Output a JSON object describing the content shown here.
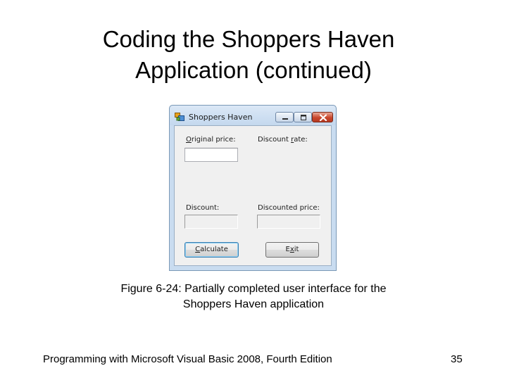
{
  "slide": {
    "title_line1": "Coding the Shoppers Haven",
    "title_line2": "Application (continued)",
    "caption_line1": "Figure 6-24: Partially completed user interface for the",
    "caption_line2": "Shoppers Haven application",
    "footer": "Programming with Microsoft Visual Basic 2008, Fourth Edition",
    "page_number": "35"
  },
  "window": {
    "title": "Shoppers Haven",
    "icon": "app-form-icon",
    "controls": [
      "minimize-icon",
      "maximize-icon",
      "close-icon"
    ]
  },
  "form": {
    "original_price_label": {
      "mnemonic": "O",
      "rest": "riginal price:"
    },
    "discount_rate_label": {
      "pre": "Discount ",
      "mnemonic": "r",
      "rest": "ate:"
    },
    "discount_label": "Discount:",
    "discounted_price_label": "Discounted price:",
    "calculate_button": {
      "mnemonic": "C",
      "rest": "alculate"
    },
    "exit_button": {
      "pre": "E",
      "mnemonic": "x",
      "rest": "it"
    }
  },
  "colors": {
    "window_frame": "#c9dcf0",
    "form_background": "#f0f0f0",
    "close_button": "#c8452b"
  }
}
